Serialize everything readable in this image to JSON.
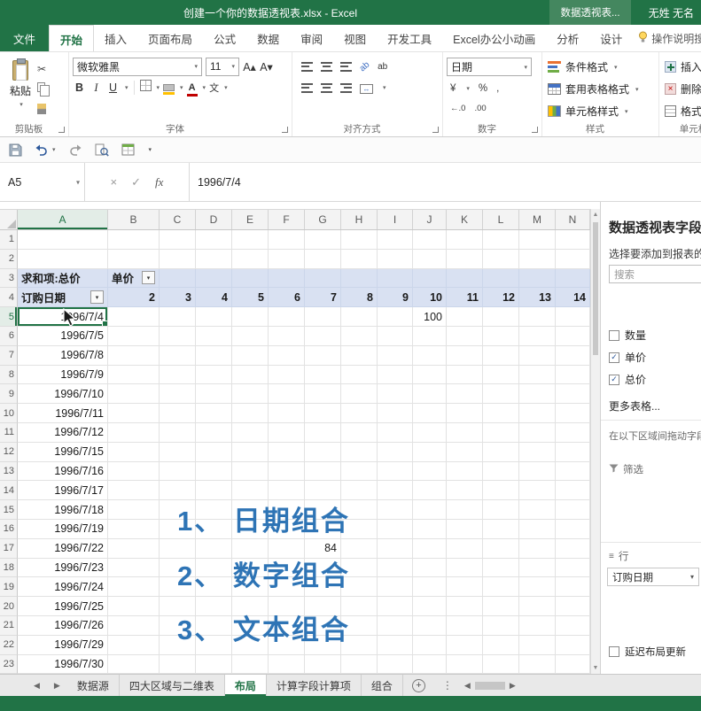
{
  "colors": {
    "excel_green": "#217346",
    "contextual_green": "#44875F",
    "pivot_header_fill": "#D9E1F2",
    "annotation_blue": "#2E74B5",
    "selection_border": "#217346"
  },
  "title_bar": {
    "document_title": "创建一个你的数据透视表.xlsx  -  Excel",
    "contextual_tool_label": "数据透视表...",
    "user_name": "无姓 无名"
  },
  "ribbon": {
    "tabs": [
      {
        "label": "文件",
        "kind": "file"
      },
      {
        "label": "开始",
        "kind": "active"
      },
      {
        "label": "插入",
        "kind": "normal"
      },
      {
        "label": "页面布局",
        "kind": "normal"
      },
      {
        "label": "公式",
        "kind": "normal"
      },
      {
        "label": "数据",
        "kind": "normal"
      },
      {
        "label": "审阅",
        "kind": "normal"
      },
      {
        "label": "视图",
        "kind": "normal"
      },
      {
        "label": "开发工具",
        "kind": "normal"
      },
      {
        "label": "Excel办公小动画",
        "kind": "normal"
      },
      {
        "label": "分析",
        "kind": "contextual"
      },
      {
        "label": "设计",
        "kind": "contextual"
      }
    ],
    "tell_me": "操作说明搜索",
    "groups": {
      "clipboard": {
        "label": "剪贴板",
        "paste": "粘贴"
      },
      "font": {
        "label": "字体",
        "font_name": "微软雅黑",
        "font_size": "11"
      },
      "alignment": {
        "label": "对齐方式"
      },
      "number": {
        "label": "数字",
        "format": "日期"
      },
      "styles": {
        "label": "样式",
        "conditional": "条件格式",
        "format_as_table": "套用表格格式",
        "cell_styles": "单元格样式"
      },
      "cells": {
        "label": "单元格",
        "insert": "插入",
        "delete": "删除",
        "format": "格式"
      }
    }
  },
  "formula_bar": {
    "name_box": "A5",
    "content": "1996/7/4"
  },
  "grid": {
    "columns": [
      "A",
      "B",
      "C",
      "D",
      "E",
      "F",
      "G",
      "H",
      "I",
      "J",
      "K",
      "L",
      "M",
      "N"
    ],
    "row_count": 23,
    "selected_cell": "A5",
    "pivot": {
      "a3": "求和项:总价",
      "b3": "单价",
      "a4": "订购日期",
      "col_headers": [
        "2",
        "3",
        "4",
        "5",
        "6",
        "7",
        "8",
        "9",
        "10",
        "11",
        "12",
        "13",
        "14"
      ]
    },
    "dates": [
      "1996/7/4",
      "1996/7/5",
      "1996/7/8",
      "1996/7/9",
      "1996/7/10",
      "1996/7/11",
      "1996/7/12",
      "1996/7/15",
      "1996/7/16",
      "1996/7/17",
      "1996/7/18",
      "1996/7/19",
      "1996/7/22",
      "1996/7/23",
      "1996/7/24",
      "1996/7/25",
      "1996/7/26",
      "1996/7/29",
      "1996/7/30"
    ],
    "j5_value": "100",
    "g17_value": "84"
  },
  "annotations": [
    "1、 日期组合",
    "2、 数字组合",
    "3、 文本组合"
  ],
  "fields_panel": {
    "title": "数据透视表字段",
    "subtitle": "选择要添加到报表的字段:",
    "search_placeholder": "搜索",
    "fields": [
      {
        "name": "数量",
        "checked": false
      },
      {
        "name": "单价",
        "checked": true
      },
      {
        "name": "总价",
        "checked": true
      }
    ],
    "more_tables": "更多表格...",
    "drag_hint": "在以下区域间拖动字段:",
    "filter_area_label": "筛选",
    "rows_area_label": "行",
    "rows_area_item": "订购日期",
    "defer_label": "延迟布局更新"
  },
  "sheet_bar": {
    "tabs": [
      {
        "label": "数据源",
        "active": false
      },
      {
        "label": "四大区域与二维表",
        "active": false
      },
      {
        "label": "布局",
        "active": true
      },
      {
        "label": "计算字段计算项",
        "active": false
      },
      {
        "label": "组合",
        "active": false
      }
    ]
  },
  "glyphs": {
    "down_arrow": "▾",
    "grow_font": "A▴",
    "shrink_font": "A▾",
    "bold": "B",
    "italic": "I",
    "underline": "U",
    "scissors": "✂",
    "pinyin": "文",
    "merge": "↔",
    "orient": "ab",
    "wrap": "ab",
    "yen": "¥",
    "percent": "%",
    "comma": ",",
    "dec_inc": "←.0",
    "dec_dec": ".00",
    "cancel": "×",
    "check": "✓",
    "fx": "fx",
    "left_arrow": "◀",
    "right_arrow": "▶",
    "up_scroll": "▲",
    "down_scroll": "▼",
    "dots": "⋮",
    "plus": "+",
    "lines": "≡"
  }
}
